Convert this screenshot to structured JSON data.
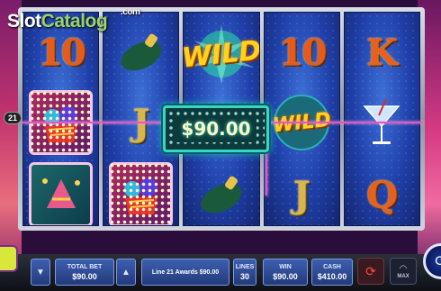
{
  "branding": {
    "logo_slot": "Slot",
    "logo_catalog": "Catalog",
    "logo_com": ".com"
  },
  "reels": {
    "r1": {
      "top": "10",
      "mid": "fireworks-symbol",
      "bot": "bonus-symbol"
    },
    "r2": {
      "top": "bottle-symbol",
      "mid": "J",
      "bot": "fireworks-symbol"
    },
    "r3": {
      "top_wild": "WILD",
      "bot": "bottle-symbol"
    },
    "r4": {
      "top": "10",
      "mid_wild": "WILD",
      "bot": "J"
    },
    "r5": {
      "top": "K",
      "mid": "martini-symbol",
      "bot": "Q"
    }
  },
  "win": {
    "line_number": "21",
    "award": "$90.00"
  },
  "controls": {
    "total_bet_label": "TOTAL BET",
    "total_bet_value": "$90.00",
    "message": "Line 21 Awards $90.00",
    "lines_label": "LINES",
    "lines_value": "30",
    "win_label": "WIN",
    "win_value": "$90.00",
    "cash_label": "CASH",
    "cash_value": "$410.00",
    "max_label": "MAX"
  },
  "colors": {
    "reel_blue": "#1f3fa8",
    "win_line": "#e05ac0",
    "award_border": "#37d6c4"
  }
}
